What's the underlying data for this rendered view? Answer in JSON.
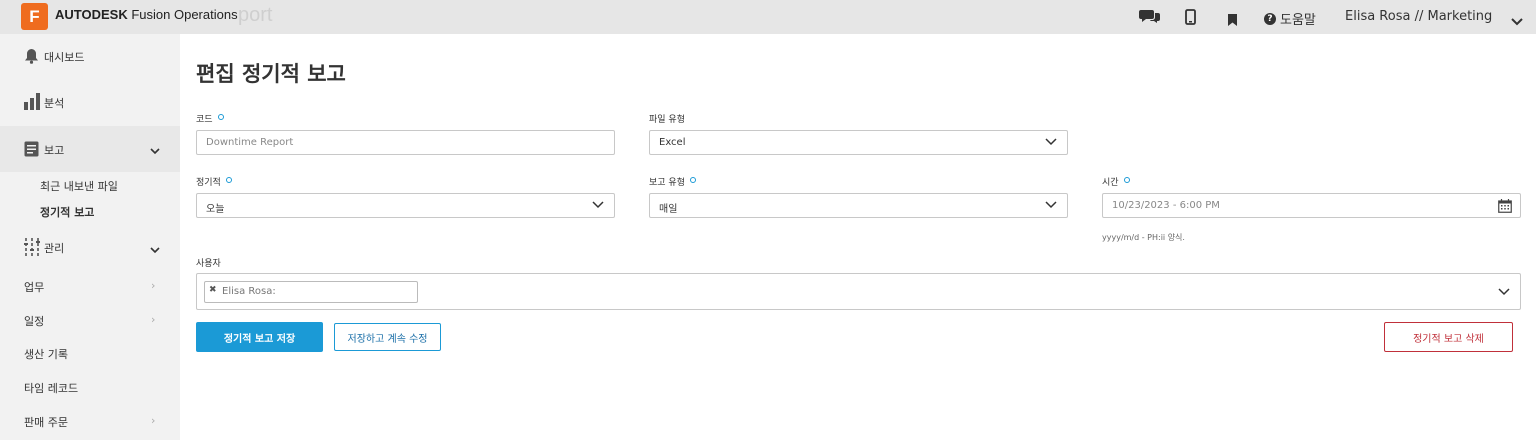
{
  "app": {
    "logo_letter": "F",
    "brand_bold": "AUTODESK",
    "brand_rest": "Fusion Operations",
    "ghost_text": "port",
    "help_label": "도움말",
    "user_label": "Elisa Rosa // Marketing",
    "accent_color": "#1b9ad6",
    "logo_color": "#ef6c1f"
  },
  "sidebar": {
    "dashboard": "대시보드",
    "analysis": "분석",
    "reports": "보고",
    "recent_exports": "최근 내보낸 파일",
    "scheduled_reports": "정기적 보고",
    "management": "관리",
    "tasks": "업무",
    "schedule": "일정",
    "production_records": "생산 기록",
    "time_records": "타임 레코드",
    "sales_orders": "판매 주문"
  },
  "form": {
    "title": "편집 정기적 보고",
    "code_label": "코드",
    "code_placeholder": "Downtime Report",
    "file_type_label": "파일 유형",
    "file_type_value": "Excel",
    "recurring_label": "정기적",
    "recurring_value": "오늘",
    "report_type_label": "보고 유형",
    "report_type_value": "매일",
    "time_label": "시간",
    "time_placeholder": "10/23/2023 - 6:00 PM",
    "time_hint": "yyyy/m/d - PH:ii 양식.",
    "users_label": "사용자",
    "user_tag": "Elisa Rosa:"
  },
  "actions": {
    "save": "정기적 보고 저장",
    "save_continue": "저장하고 계속 수정",
    "delete": "정기적 보고 삭제"
  }
}
